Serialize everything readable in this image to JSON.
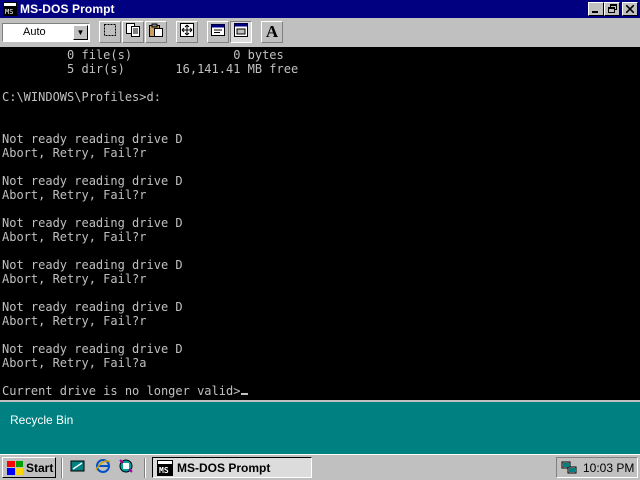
{
  "window": {
    "title": "MS-DOS Prompt",
    "controls": [
      "minimize-icon",
      "restore-icon",
      "close-icon"
    ]
  },
  "toolbar": {
    "font_size_value": "Auto",
    "tools": [
      "mark-icon",
      "copy-icon",
      "paste-icon",
      "full-screen-icon",
      "properties-icon",
      "background-icon",
      "font-icon"
    ],
    "font_button_label": "A"
  },
  "console": {
    "lines": [
      "         0 file(s)              0 bytes",
      "         5 dir(s)       16,141.41 MB free",
      "",
      "C:\\WINDOWS\\Profiles>d:",
      "",
      "",
      "Not ready reading drive D",
      "Abort, Retry, Fail?r",
      "",
      "Not ready reading drive D",
      "Abort, Retry, Fail?r",
      "",
      "Not ready reading drive D",
      "Abort, Retry, Fail?r",
      "",
      "Not ready reading drive D",
      "Abort, Retry, Fail?r",
      "",
      "Not ready reading drive D",
      "Abort, Retry, Fail?r",
      "",
      "Not ready reading drive D",
      "Abort, Retry, Fail?a",
      "",
      "Current drive is no longer valid>"
    ],
    "colors": {
      "background": "#000000",
      "text": "#c0c0c0"
    }
  },
  "desktop": {
    "recycle_bin_label": "Recycle Bin",
    "background_color": "#008080"
  },
  "taskbar": {
    "start_label": "Start",
    "quick_launch": [
      "show-desktop-icon",
      "internet-explorer-icon",
      "channels-icon"
    ],
    "task_label": "MS-DOS Prompt",
    "clock": "10:03 PM",
    "tray_icons": [
      "network-tray-icon"
    ]
  },
  "colors": {
    "title_bar": "#000080",
    "face": "#c0c0c0"
  }
}
